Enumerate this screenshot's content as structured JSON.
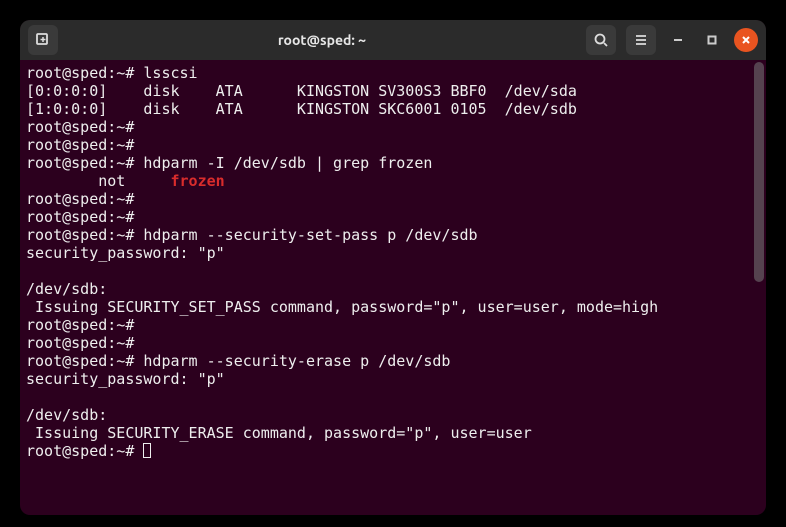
{
  "titlebar": {
    "title": "root@sped: ~"
  },
  "prompt": "root@sped:~#",
  "lines": [
    {
      "type": "cmd",
      "text": "lsscsi"
    },
    {
      "type": "out",
      "text": "[0:0:0:0]    disk    ATA      KINGSTON SV300S3 BBF0  /dev/sda"
    },
    {
      "type": "out",
      "text": "[1:0:0:0]    disk    ATA      KINGSTON SKC6001 0105  /dev/sdb"
    },
    {
      "type": "cmd",
      "text": ""
    },
    {
      "type": "cmd",
      "text": ""
    },
    {
      "type": "cmd",
      "text": "hdparm -I /dev/sdb | grep frozen"
    },
    {
      "type": "grep",
      "prefix": "        not     ",
      "match": "frozen"
    },
    {
      "type": "cmd",
      "text": ""
    },
    {
      "type": "cmd",
      "text": ""
    },
    {
      "type": "cmd",
      "text": "hdparm --security-set-pass p /dev/sdb"
    },
    {
      "type": "out",
      "text": "security_password: \"p\""
    },
    {
      "type": "out",
      "text": ""
    },
    {
      "type": "out",
      "text": "/dev/sdb:"
    },
    {
      "type": "out",
      "text": " Issuing SECURITY_SET_PASS command, password=\"p\", user=user, mode=high"
    },
    {
      "type": "cmd",
      "text": ""
    },
    {
      "type": "cmd",
      "text": ""
    },
    {
      "type": "cmd",
      "text": "hdparm --security-erase p /dev/sdb"
    },
    {
      "type": "out",
      "text": "security_password: \"p\""
    },
    {
      "type": "out",
      "text": ""
    },
    {
      "type": "out",
      "text": "/dev/sdb:"
    },
    {
      "type": "out",
      "text": " Issuing SECURITY_ERASE command, password=\"p\", user=user"
    },
    {
      "type": "cursor"
    }
  ]
}
